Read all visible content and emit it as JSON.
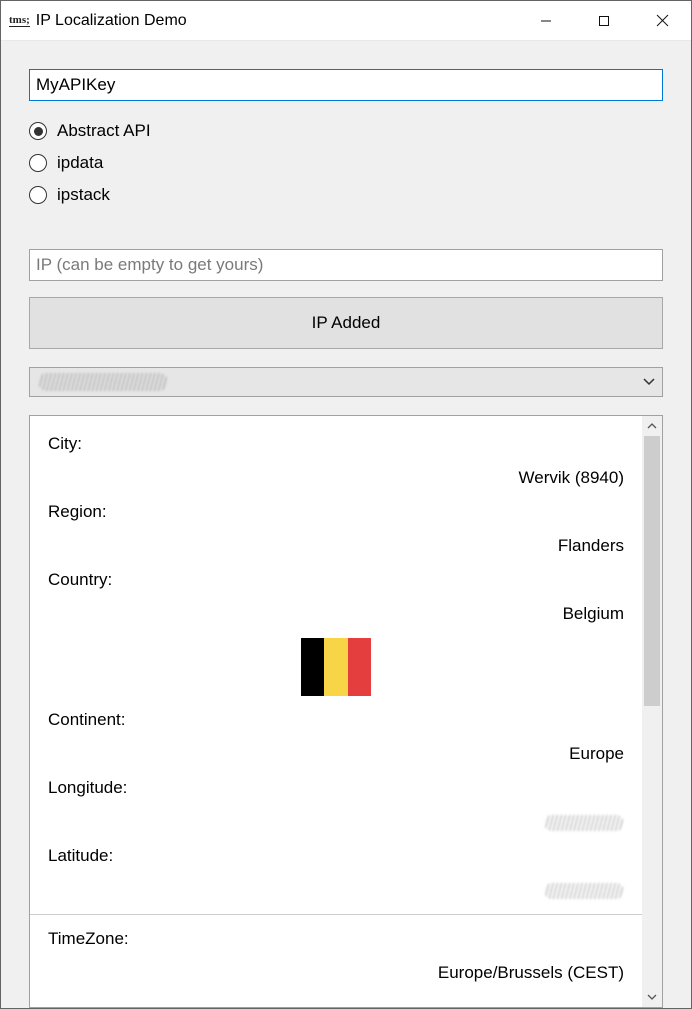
{
  "window": {
    "icon_text": "tms;",
    "title": "IP Localization Demo"
  },
  "api_key": {
    "value": "MyAPIKey"
  },
  "providers": {
    "selected_index": 0,
    "options": [
      "Abstract API",
      "ipdata",
      "ipstack"
    ]
  },
  "ip_input": {
    "placeholder": "IP (can be empty to get yours)",
    "value": ""
  },
  "action_button": {
    "label": "IP Added"
  },
  "results": {
    "city_label": "City:",
    "city_value": "Wervik (8940)",
    "region_label": "Region:",
    "region_value": "Flanders",
    "country_label": "Country:",
    "country_value": "Belgium",
    "flag": {
      "colors": [
        "#000000",
        "#F8D447",
        "#E53E3E"
      ],
      "country_code": "BE"
    },
    "continent_label": "Continent:",
    "continent_value": "Europe",
    "longitude_label": "Longitude:",
    "latitude_label": "Latitude:",
    "timezone_label": "TimeZone:",
    "timezone_value": "Europe/Brussels (CEST)"
  }
}
